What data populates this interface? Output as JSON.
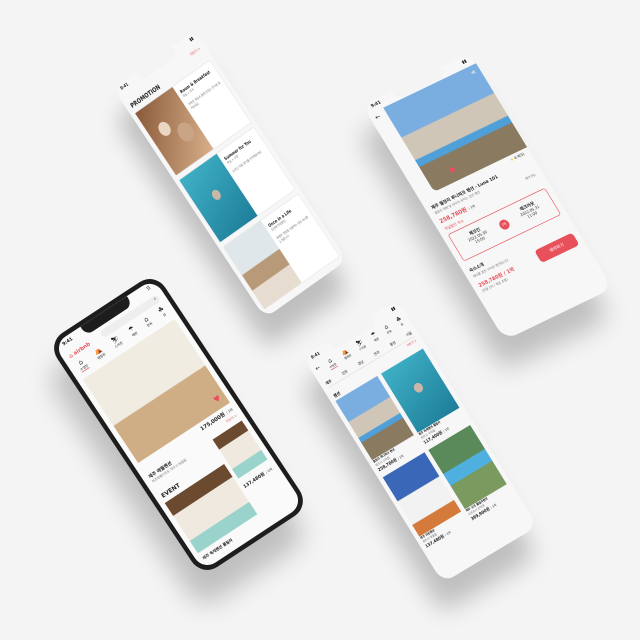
{
  "colors": {
    "accent": "#e8505b",
    "background": "#f4f4f4"
  },
  "promo": {
    "time": "9:41",
    "more": "더보기 >",
    "heading": "PROMOTION",
    "cards": [
      {
        "title": "Room & Breakfast",
        "sub": "객실 + 조식",
        "desc": "안락한 객실과 함께 맛있는 조식을 즐겨보세요"
      },
      {
        "title": "Summer for You",
        "sub": "객실 + 수영",
        "desc": "눈부신 여름 휴가를 만끽해보세요"
      },
      {
        "title": "Once in a Life",
        "sub": "인생에 한번뿐인",
        "desc": "특별한 경험을 선물하는 감성 숙소를 소개합니다"
      }
    ]
  },
  "detail": {
    "time": "9:41",
    "rating": "4.4(5)",
    "title": "제주 월정리 루나파크 펜션 - Luna 101",
    "desc": "월정리 해변 앞 바다가 보이는 감성 펜션",
    "price": "258,780원",
    "per": "/ 1박",
    "available": "예약가능",
    "discount": "객실할인 숙소",
    "checkin_label": "체크인",
    "checkin_date": "2022.05.30",
    "checkin_time": "15:00",
    "nights": "1박",
    "checkout_label": "체크아웃",
    "checkout_date": "2022.05.31",
    "checkout_time": "11:00",
    "intro": "숙소소개",
    "intro_desc": "바다를 품은 아늑한 펜션입니다",
    "bottom_price": "258,780원 / 1박",
    "bottom_sub": "(전월 1박 / 세금 포함)",
    "book": "예약하기"
  },
  "home": {
    "time": "9:41",
    "logo": "airbnb",
    "cats": [
      "수영장",
      "캠핑장",
      "스키장",
      "해변",
      "한옥",
      "섬"
    ],
    "price": "175,000원",
    "per": "/ 1박",
    "more": "더보기 >",
    "name": "제주 애월펜션",
    "addr": "제주특별자치도 제주시 애월읍",
    "event": "EVENT",
    "event_price": "137,480원",
    "event_per": "/ 1박",
    "event_name": "제주 독채펜션 풀빌라"
  },
  "list": {
    "time": "9:41",
    "cats": [
      "수영장",
      "캠핑장",
      "스키장",
      "해변",
      "한옥",
      "섬"
    ],
    "regions": [
      "제주",
      "강원",
      "경남",
      "전라",
      "충청",
      "서울"
    ],
    "more": "더보기 >",
    "section": "펜션",
    "items": [
      {
        "name": "월정리 루나파크 펜션",
        "addr": "제주시 구좌읍",
        "price": "258,780원",
        "per": "/ 1박"
      },
      {
        "name": "제주 독채펜션 풀빌라",
        "addr": "제주시 구좌읍",
        "price": "117,400원",
        "per": "/ 1박"
      },
      {
        "name": "제주 타운펜션",
        "addr": "제주시 애월읍",
        "price": "137,480원",
        "per": "/ 1박"
      },
      {
        "name": "제주 오션 풀빌라펜션",
        "addr": "서귀포시 안덕면",
        "price": "399,900원",
        "per": "/ 1박"
      }
    ]
  }
}
